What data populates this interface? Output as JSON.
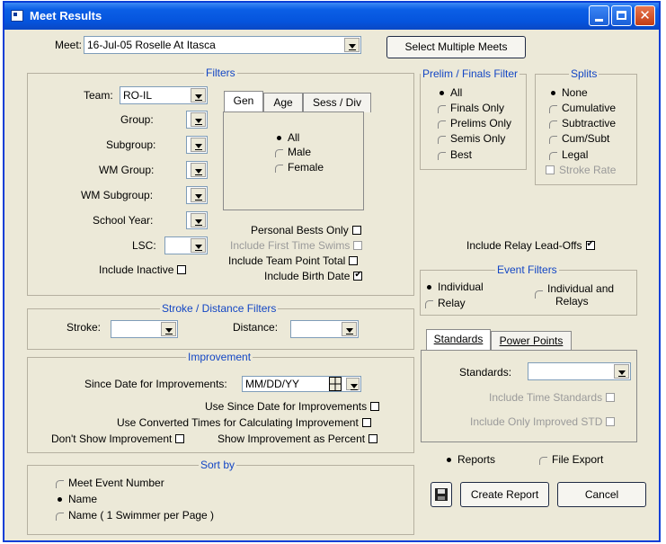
{
  "window": {
    "title": "Meet Results"
  },
  "meet": {
    "label": "Meet:",
    "value": "16-Jul-05 Roselle At Itasca",
    "select_multiple": "Select Multiple Meets"
  },
  "filters": {
    "legend": "Filters",
    "team_label": "Team:",
    "team_value": "RO-IL",
    "group_label": "Group:",
    "subgroup_label": "Subgroup:",
    "wm_group_label": "WM Group:",
    "wm_subgroup_label": "WM Subgroup:",
    "school_year_label": "School Year:",
    "lsc_label": "LSC:",
    "include_inactive": "Include Inactive",
    "tabs": [
      "Gen",
      "Age",
      "Sess / Div"
    ],
    "gender_options": [
      "All",
      "Male",
      "Female"
    ],
    "personal_bests": "Personal Bests Only",
    "first_time_swims": "Include First Time Swims",
    "team_point_total": "Include Team Point Total",
    "birth_date": "Include Birth Date"
  },
  "prelim_finals": {
    "legend": "Prelim / Finals Filter",
    "options": [
      "All",
      "Finals Only",
      "Prelims Only",
      "Semis Only",
      "Best"
    ]
  },
  "splits": {
    "legend": "Splits",
    "options": [
      "None",
      "Cumulative",
      "Subtractive",
      "Cum/Subt",
      "Legal"
    ],
    "stroke_rate": "Stroke Rate"
  },
  "relay_leadoffs": "Include Relay Lead-Offs",
  "event_filters": {
    "legend": "Event Filters",
    "individual": "Individual",
    "relay": "Relay",
    "individual_and": "Individual and",
    "relays": "Relays"
  },
  "stroke_distance": {
    "legend": "Stroke / Distance Filters",
    "stroke_label": "Stroke:",
    "distance_label": "Distance:"
  },
  "improvement": {
    "legend": "Improvement",
    "since_date_label": "Since Date for Improvements:",
    "since_date_value": "MM/DD/YY",
    "use_since_date": "Use Since Date for Improvements",
    "use_converted": "Use Converted Times for Calculating Improvement",
    "dont_show": "Don't Show Improvement",
    "show_percent": "Show Improvement as Percent"
  },
  "standards_tabs": {
    "standards": "Standards",
    "power_points": "Power Points"
  },
  "standards": {
    "label": "Standards:",
    "include_time": "Include Time Standards",
    "include_improved": "Include Only Improved STD"
  },
  "sort_by": {
    "legend": "Sort by",
    "options": [
      "Meet Event Number",
      "Name",
      "Name ( 1 Swimmer per Page )"
    ]
  },
  "output": {
    "reports": "Reports",
    "file_export": "File Export"
  },
  "actions": {
    "create_report": "Create Report",
    "cancel": "Cancel"
  }
}
